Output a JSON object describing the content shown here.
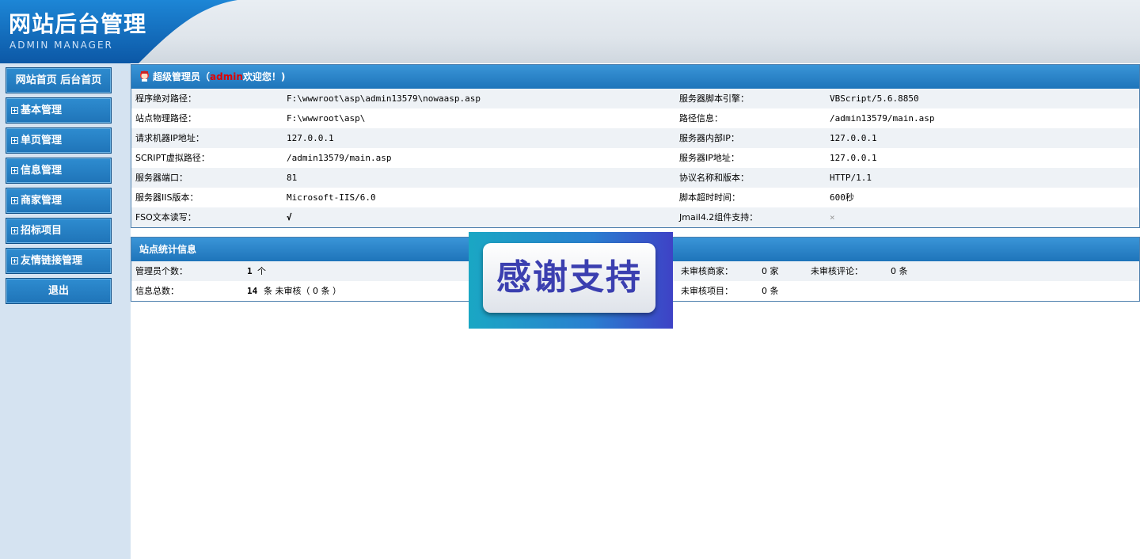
{
  "header": {
    "title": "网站后台管理",
    "subtitle": "ADMIN MANAGER"
  },
  "sidebar": {
    "top_links": [
      "网站首页",
      "后台首页"
    ],
    "items": [
      {
        "label": "基本管理"
      },
      {
        "label": "单页管理"
      },
      {
        "label": "信息管理"
      },
      {
        "label": "商家管理"
      },
      {
        "label": "招标项目"
      },
      {
        "label": "友情链接管理"
      }
    ],
    "logout": "退出"
  },
  "welcome": {
    "prefix": "超级管理员（",
    "user": "admin",
    "suffix": "欢迎您！)"
  },
  "server_info": [
    {
      "l1": "程序绝对路径：",
      "v1": "F:\\wwwroot\\asp\\admin13579\\nowaasp.asp",
      "l2": "服务器脚本引擎：",
      "v2": "VBScript/5.6.8850"
    },
    {
      "l1": "站点物理路径：",
      "v1": "F:\\wwwroot\\asp\\",
      "l2": "路径信息：",
      "v2": "/admin13579/main.asp"
    },
    {
      "l1": "请求机器IP地址：",
      "v1": "127.0.0.1",
      "l2": "服务器内部IP：",
      "v2": "127.0.0.1"
    },
    {
      "l1": "SCRIPT虚拟路径：",
      "v1": "/admin13579/main.asp",
      "l2": "服务器IP地址：",
      "v2": "127.0.0.1"
    },
    {
      "l1": "服务器端口：",
      "v1": "81",
      "l2": "协议名称和版本：",
      "v2": "HTTP/1.1"
    },
    {
      "l1": "服务器IIS版本：",
      "v1": "Microsoft-IIS/6.0",
      "l2": "脚本超时时间：",
      "v2": "600秒"
    },
    {
      "l1": "FSO文本读写：",
      "v1": "√",
      "l2": "Jmail4.2组件支持：",
      "v2": "×"
    }
  ],
  "stats": {
    "title": "站点统计信息",
    "admin_count_label": "管理员个数：",
    "admin_count": "1",
    "admin_unit": "个",
    "info_total_label": "信息总数：",
    "info_total": "14",
    "info_total_unit": "条 未审核（ 0 条 ）",
    "pending_merchant_label": "未审核商家：",
    "pending_merchant": "0 家",
    "pending_review_label": "未审核评论：",
    "pending_review": "0 条",
    "pending_project_label": "未审核项目：",
    "pending_project": "0 条"
  },
  "promo": {
    "text": "感谢支持"
  }
}
